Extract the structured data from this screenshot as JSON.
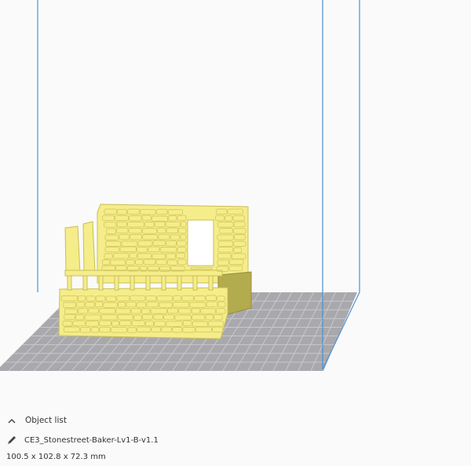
{
  "object_list": {
    "label": "Object list",
    "toggle_icon": "chevron-up-icon"
  },
  "selected_object": {
    "name": "CE3_Stonestreet-Baker-Lv1-B-v1.1",
    "edit_icon": "pencil-icon",
    "dimensions": "100.5 x 102.8 x 72.3 mm"
  },
  "colors": {
    "model": "#f5ec8a",
    "build_volume_edge": "#4a90d9",
    "plate": "#a9a9ad",
    "plate_grid": "#c9c9ce"
  }
}
